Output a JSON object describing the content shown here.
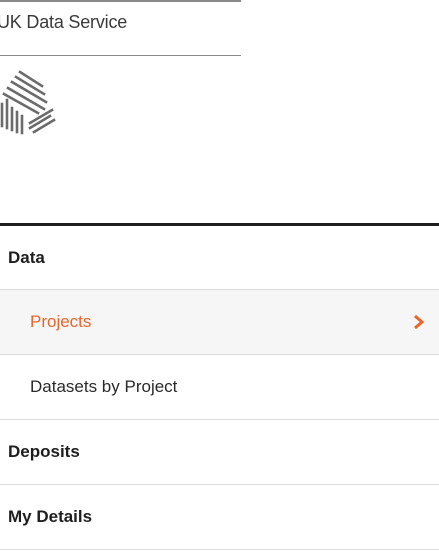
{
  "brand": {
    "name": "UK Data Service",
    "logo_icon": "uk-data-service-logo-icon"
  },
  "nav": {
    "items": [
      {
        "label": "Data",
        "kind": "section"
      },
      {
        "label": "Projects",
        "kind": "sub",
        "active": true,
        "icon": "chevron-right-icon"
      },
      {
        "label": "Datasets by Project",
        "kind": "sub"
      },
      {
        "label": "Deposits",
        "kind": "section"
      },
      {
        "label": "My Details",
        "kind": "section"
      }
    ]
  },
  "colors": {
    "accent": "#e8662d",
    "active_bg": "#f6f6f6",
    "divider": "#dcdcdc",
    "top_border": "#1f1f1f"
  }
}
